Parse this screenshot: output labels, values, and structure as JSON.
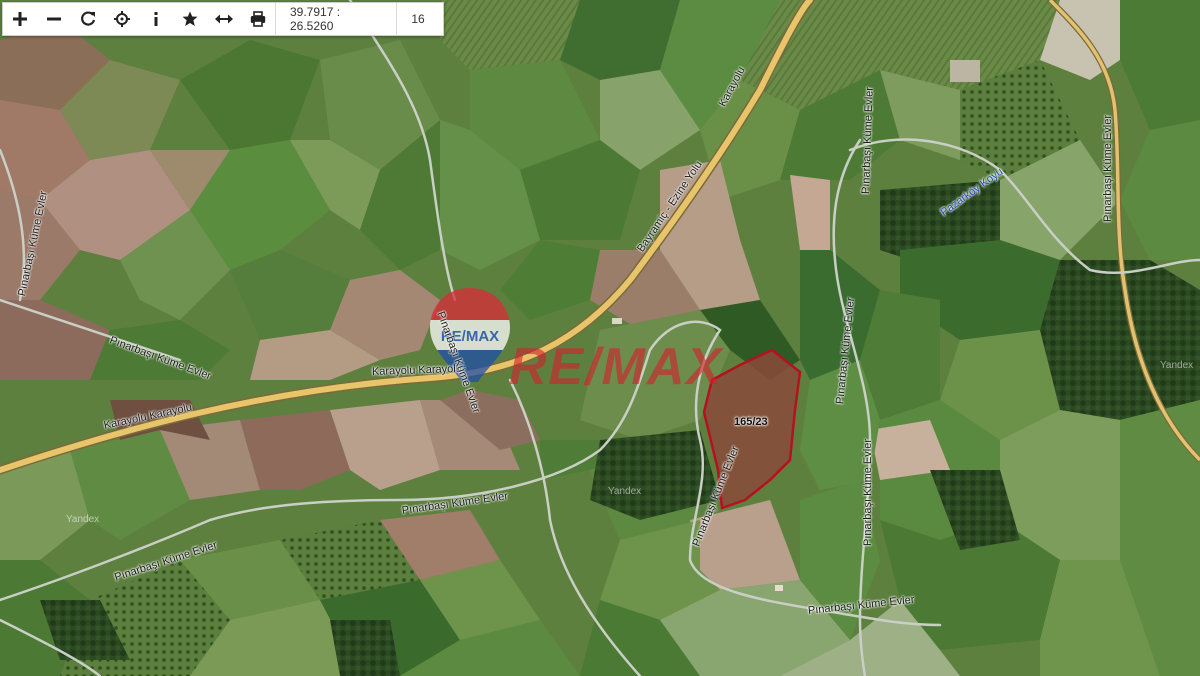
{
  "toolbar": {
    "buttons": [
      {
        "name": "zoom-in-icon",
        "glyph": "+"
      },
      {
        "name": "zoom-out-icon",
        "glyph": "−"
      },
      {
        "name": "refresh-icon",
        "glyph": "↻"
      },
      {
        "name": "crosshair-icon",
        "glyph": "⌖"
      },
      {
        "name": "info-icon",
        "glyph": "i"
      },
      {
        "name": "star-icon",
        "glyph": "★"
      },
      {
        "name": "measure-icon",
        "glyph": "↔"
      },
      {
        "name": "print-icon",
        "glyph": "⎙"
      }
    ],
    "coordinates": "39.7917 : 26.5260",
    "zoom_level": "16"
  },
  "map": {
    "labels": {
      "karayolu_1": "Karayolu Karayolu",
      "karayolu_2": "Karayolu Karayolu",
      "karayolu_3": "Karayolu",
      "bayramic": "Bayramiç - Ezine Yolu",
      "pinarbasi_1": "Pınarbaşı Küme Evler",
      "pinarbasi_2": "Pınarbaşı Küme Evler",
      "pinarbasi_3": "Pınarbaşı Küme Evler",
      "pinarbasi_4": "Pınarbaşı Küme Evler",
      "pinarbasi_5": "Pınarbaşı Küme Evler",
      "pinarbasi_6": "Pınarbaşı Küme Evler",
      "pinarbasi_7": "Pınarbaşı Küme Evler",
      "pinarbasi_8": "Pınarbaşı Küme Evler",
      "pinarbasi_9": "Pınarbaşı Küme Evler",
      "pinarbasi_10": "Pınarbaşı Küme Evler",
      "pinarbasi_11": "Pınarbaşı Küme Evler",
      "pazarkoy": "Pazarköy Koyu",
      "yandex_1": "Yandex",
      "yandex_2": "Yandex",
      "yandex_3": "Yandex"
    },
    "parcel_label": "165/23",
    "watermark": "RE/MAX",
    "balloon_text": "RE/MAX",
    "colors": {
      "road": "#e8c46a",
      "parcel_outline": "#b4121f",
      "parcel_fill": "#8a4a3a",
      "field_green": "#4f7d3a"
    }
  }
}
